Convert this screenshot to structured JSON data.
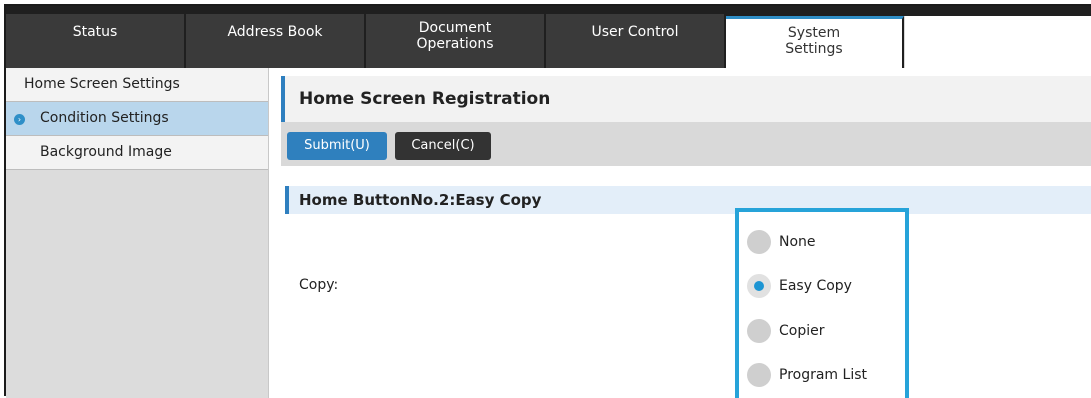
{
  "tabs": [
    {
      "label": "Status",
      "active": false
    },
    {
      "label": "Address Book",
      "active": false
    },
    {
      "label": "Document\nOperations",
      "active": false
    },
    {
      "label": "User Control",
      "active": false
    },
    {
      "label": "System\nSettings",
      "active": true
    }
  ],
  "sidebar": {
    "items": [
      {
        "label": "Home Screen Settings",
        "active": false
      },
      {
        "label": "Condition Settings",
        "active": true
      },
      {
        "label": "Background Image",
        "active": false
      }
    ]
  },
  "main": {
    "title": "Home Screen Registration",
    "submit_label": "Submit(U)",
    "cancel_label": "Cancel(C)",
    "section_title": "Home ButtonNo.2:Easy Copy",
    "field_label": "Copy:",
    "options": [
      {
        "label": "None",
        "selected": false
      },
      {
        "label": "Easy Copy",
        "selected": true
      },
      {
        "label": "Copier",
        "selected": false
      },
      {
        "label": "Program List",
        "selected": false
      }
    ]
  },
  "colors": {
    "accent": "#2e7fbf",
    "highlight_box": "#26a3d9",
    "tab_bg": "#3a3a3a",
    "sidebar_active": "#b9d6ec"
  }
}
